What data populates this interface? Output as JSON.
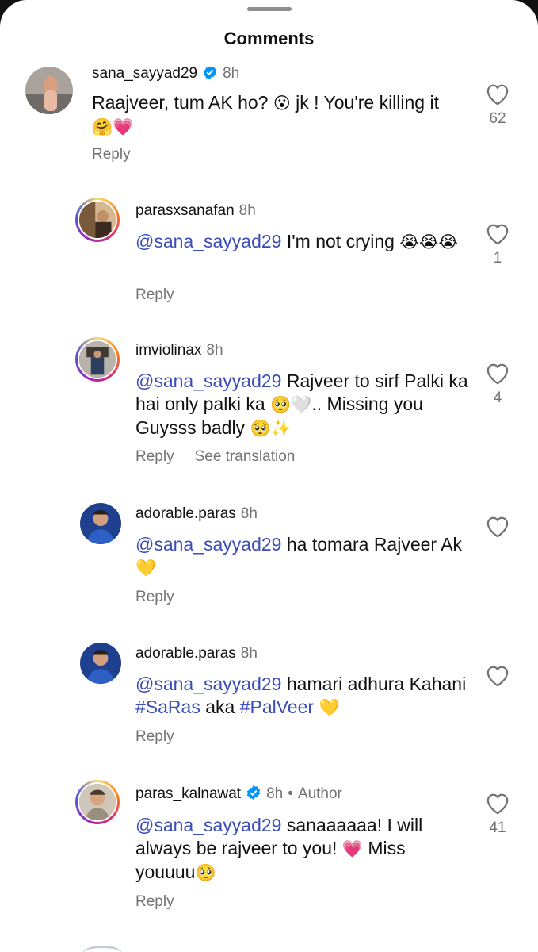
{
  "header": {
    "title": "Comments"
  },
  "comments": [
    {
      "username": "sana_sayyad29",
      "verified": true,
      "time": "8h",
      "parts": [
        {
          "t": "text",
          "v": "Raajveer, tum AK ho? "
        },
        {
          "t": "emoji",
          "v": "😮"
        },
        {
          "t": "text",
          "v": " jk !  You're killing it "
        },
        {
          "t": "emoji",
          "v": "🤗"
        },
        {
          "t": "emoji",
          "v": "💗"
        }
      ],
      "reply_label": "Reply",
      "likes": "62"
    },
    {
      "username": "parasxsanafan",
      "time": "8h",
      "parts": [
        {
          "t": "mention",
          "v": "@sana_sayyad29"
        },
        {
          "t": "text",
          "v": " I'm not crying "
        },
        {
          "t": "emoji",
          "v": "😭"
        },
        {
          "t": "emoji",
          "v": "😭"
        },
        {
          "t": "emoji",
          "v": "😭"
        }
      ],
      "reply_label": "Reply",
      "likes": "1"
    },
    {
      "username": "imviolinax",
      "time": "8h",
      "parts": [
        {
          "t": "mention",
          "v": "@sana_sayyad29"
        },
        {
          "t": "text",
          "v": " Rajveer to sirf Palki ka hai only palki ka "
        },
        {
          "t": "emoji",
          "v": "🥺"
        },
        {
          "t": "emoji",
          "v": "🤍"
        },
        {
          "t": "text",
          "v": ".. Missing you Guysss badly "
        },
        {
          "t": "emoji",
          "v": "🥺"
        },
        {
          "t": "emoji",
          "v": "✨"
        }
      ],
      "reply_label": "Reply",
      "translate_label": "See translation",
      "likes": "4"
    },
    {
      "username": "adorable.paras",
      "time": "8h",
      "parts": [
        {
          "t": "mention",
          "v": "@sana_sayyad29"
        },
        {
          "t": "text",
          "v": " ha tomara Rajveer Ak "
        },
        {
          "t": "emoji",
          "v": "💛"
        }
      ],
      "reply_label": "Reply",
      "likes": ""
    },
    {
      "username": "adorable.paras",
      "time": "8h",
      "parts": [
        {
          "t": "mention",
          "v": "@sana_sayyad29"
        },
        {
          "t": "text",
          "v": " hamari adhura Kahani "
        },
        {
          "t": "hashtag",
          "v": "#SaRas"
        },
        {
          "t": "text",
          "v": " aka "
        },
        {
          "t": "hashtag",
          "v": "#PalVeer"
        },
        {
          "t": "text",
          "v": " "
        },
        {
          "t": "emoji",
          "v": "💛"
        }
      ],
      "reply_label": "Reply",
      "likes": ""
    },
    {
      "username": "paras_kalnawat",
      "verified": true,
      "time": "8h",
      "author_label": "Author",
      "parts": [
        {
          "t": "mention",
          "v": "@sana_sayyad29"
        },
        {
          "t": "text",
          "v": " sanaaaaaa! I will always be rajveer to you! "
        },
        {
          "t": "emoji",
          "v": "💗"
        },
        {
          "t": "text",
          "v": " Miss youuuu"
        },
        {
          "t": "emoji",
          "v": "🥺"
        }
      ],
      "reply_label": "Reply",
      "likes": "41"
    }
  ],
  "colors": {
    "mention": "#3a4db8",
    "verified": "#0095f6",
    "muted": "#737373"
  }
}
